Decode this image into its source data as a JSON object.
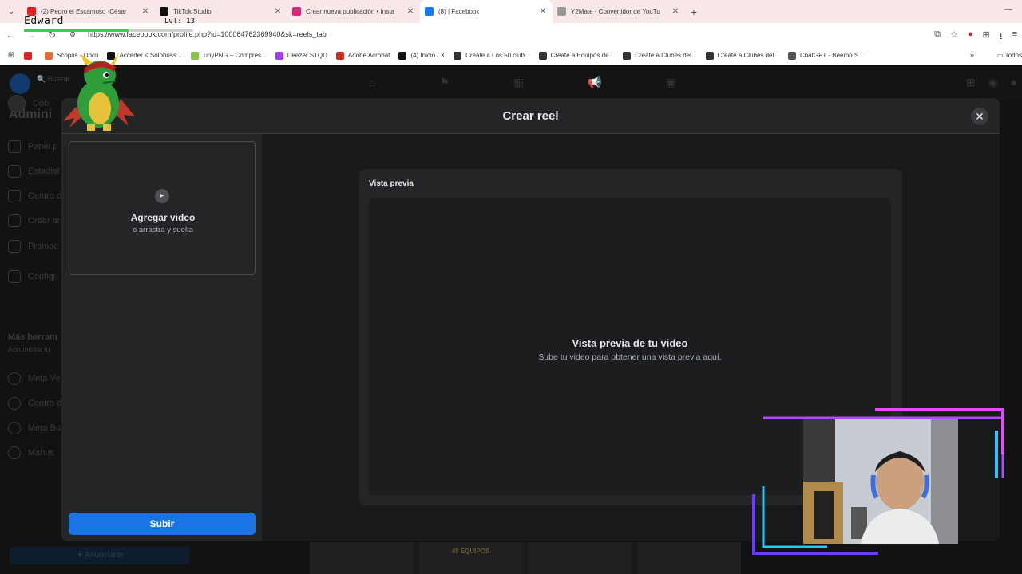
{
  "browser": {
    "tabs": [
      {
        "label": "(2) Pedro el Escamoso -César",
        "favicon": "youtube-icon",
        "color": "#e02020",
        "active": false
      },
      {
        "label": "TikTok Studio",
        "favicon": "tiktok-icon",
        "color": "#111111",
        "active": false
      },
      {
        "label": "Crear nueva publicación • Insta",
        "favicon": "instagram-icon",
        "color": "#d62976",
        "active": false
      },
      {
        "label": "(8) | Facebook",
        "favicon": "facebook-icon",
        "color": "#1877f2",
        "active": true
      },
      {
        "label": "Y2Mate - Convertidor de YouTu",
        "favicon": "y2mate-icon",
        "color": "#999999",
        "active": false
      }
    ],
    "url": "https://www.facebook.com/profile.php?id=100064762369940&sk=reels_tab",
    "bookmarks": [
      {
        "label": "",
        "color": "#e02020"
      },
      {
        "label": "Scopus - Docu",
        "color": "#e86a2e"
      },
      {
        "label": "Acceder < Solobuss...",
        "color": "#111111"
      },
      {
        "label": "TinyPNG – Compres...",
        "color": "#8bc34a"
      },
      {
        "label": "Deezer STQD",
        "color": "#a238ff"
      },
      {
        "label": "Adobe Acrobat",
        "color": "#d4271c"
      },
      {
        "label": "(4) Inicio / X",
        "color": "#111111"
      },
      {
        "label": "Create a Los 50 club...",
        "color": "#333333"
      },
      {
        "label": "Create a Equipos de...",
        "color": "#333333"
      },
      {
        "label": "Create a Clubes del...",
        "color": "#333333"
      },
      {
        "label": "Create a Clubes del...",
        "color": "#333333"
      },
      {
        "label": "ChatGPT - Beemo S...",
        "color": "#555555"
      }
    ],
    "all_bookmarks": "Todos"
  },
  "overlay": {
    "name": "Edward",
    "level": "Lvl: 13",
    "xp_progress": 0.62
  },
  "fb": {
    "search": "Buscar",
    "sidebar_title": "Admini",
    "sidebar_items": [
      {
        "label": "Dob"
      },
      {
        "label": "Panel p"
      },
      {
        "label": "Estadíst"
      },
      {
        "label": "Centro d"
      },
      {
        "label": "Crear an"
      },
      {
        "label": "Promoc Instagra"
      },
      {
        "label": "Configu"
      }
    ],
    "more_tools": "Más herram",
    "more_tools_sub": "Administra tu",
    "tools_items": [
      {
        "label": "Meta Ve"
      },
      {
        "label": "Centro d"
      },
      {
        "label": "Meta Bu"
      },
      {
        "label": "Manus"
      }
    ],
    "advertise_button": "Anunciarte",
    "bottom_badge": "48 EQUIPOS"
  },
  "modal": {
    "title": "Crear reel",
    "upload_title": "Agregar video",
    "upload_subtitle": "o arrastra y suelta",
    "submit_label": "Subir",
    "preview_label": "Vista previa",
    "preview_title": "Vista previa de tu video",
    "preview_subtitle": "Sube tu video para obtener una vista previa aquí."
  }
}
